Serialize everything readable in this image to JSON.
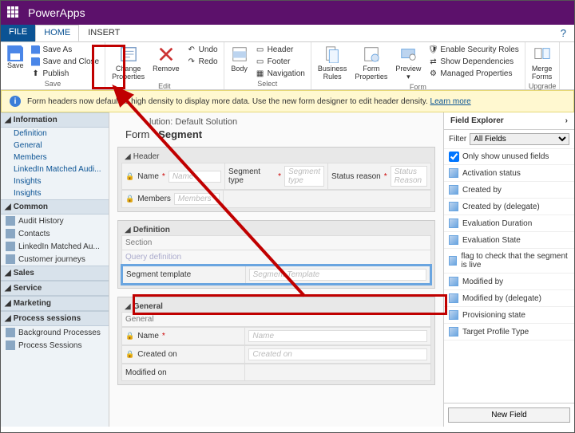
{
  "header": {
    "brand": "PowerApps"
  },
  "menus": {
    "file": "FILE",
    "home": "HOME",
    "insert": "INSERT"
  },
  "ribbon": {
    "save_group": {
      "label": "Save",
      "save": "Save",
      "save_as": "Save As",
      "save_close": "Save and Close",
      "publish": "Publish"
    },
    "edit_group": {
      "label": "Edit",
      "change_props": "Change\nProperties",
      "remove": "Remove",
      "undo": "Undo",
      "redo": "Redo"
    },
    "select_group": {
      "label": "Select",
      "body": "Body",
      "header": "Header",
      "footer": "Footer",
      "navigation": "Navigation"
    },
    "form_group": {
      "label": "Form",
      "business_rules": "Business\nRules",
      "form_props": "Form\nProperties",
      "preview": "Preview",
      "enable_roles": "Enable Security Roles",
      "show_deps": "Show Dependencies",
      "managed_props": "Managed Properties"
    },
    "upgrade_group": {
      "label": "Upgrade",
      "merge_forms": "Merge\nForms"
    }
  },
  "notice": {
    "text": "Form headers now default to high density to display more data. Use the new form designer to edit header density. ",
    "link": "Learn more"
  },
  "left": {
    "information": {
      "title": "Information",
      "items": [
        "Definition",
        "General",
        "Members",
        "LinkedIn Matched Audi...",
        "Insights",
        "Insights"
      ]
    },
    "common": {
      "title": "Common",
      "items": [
        "Audit History",
        "Contacts",
        "LinkedIn Matched Au...",
        "Customer journeys"
      ]
    },
    "sales": {
      "title": "Sales"
    },
    "service": {
      "title": "Service"
    },
    "marketing": {
      "title": "Marketing"
    },
    "process": {
      "title": "Process sessions",
      "items": [
        "Background Processes",
        "Process Sessions"
      ]
    }
  },
  "center": {
    "solution_label": "lution: Default Solution",
    "form_label": "Form",
    "entity": "Segment",
    "header_sec": {
      "title": "Header",
      "name_label": "Name",
      "name_ph": "Name",
      "segtype_label": "Segment type",
      "segtype_ph": "Segment type",
      "status_label": "Status reason",
      "status_ph": "Status Reason",
      "members_label": "Members",
      "members_ph": "Members"
    },
    "def_sec": {
      "title": "Definition",
      "section_sub": "Section",
      "query_row": "Query definition",
      "segtpl_label": "Segment template",
      "segtpl_ph": "Segment Template"
    },
    "gen_sec": {
      "title": "General",
      "sub": "General",
      "name_label": "Name",
      "name_ph": "Name",
      "created_label": "Created on",
      "created_ph": "Created on",
      "modified_label": "Modified on"
    }
  },
  "right": {
    "title": "Field Explorer",
    "filter_label": "Filter",
    "filter_value": "All Fields",
    "only_unused": "Only show unused fields",
    "fields": [
      "Activation status",
      "Created by",
      "Created by (delegate)",
      "Evaluation Duration",
      "Evaluation State",
      "flag to check that the segment is live",
      "Modified by",
      "Modified by (delegate)",
      "Provisioning state",
      "Target Profile Type"
    ],
    "new_field": "New Field"
  }
}
